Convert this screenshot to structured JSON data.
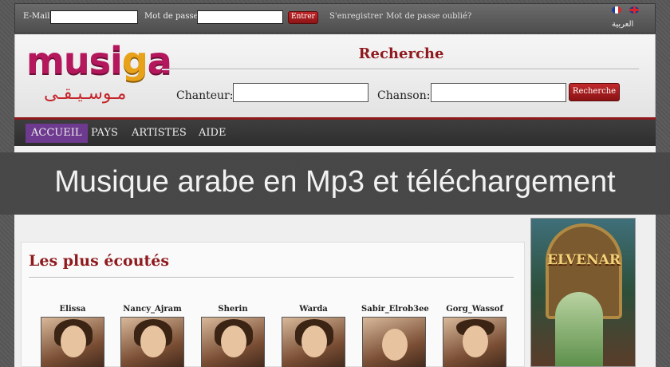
{
  "login": {
    "email_label": "E-Mail",
    "password_label": "Mot de passe",
    "enter_label": "Entrer",
    "register_label": "S'enregistrer",
    "forgot_label": "Mot de passe oublié?",
    "arabic_label": "العربية"
  },
  "header": {
    "logo_text_a": "musi",
    "logo_text_b": "g",
    "logo_text_c": "a",
    "logo_arabic": "مـوسـيـقـى",
    "search_title": "Recherche",
    "singer_label": "Chanteur:",
    "song_label": "Chanson:",
    "search_button": "Recherche"
  },
  "nav": {
    "items": [
      {
        "label": "ACCUEIL",
        "active": true
      },
      {
        "label": "PAYS",
        "active": false
      },
      {
        "label": "ARTISTES",
        "active": false
      },
      {
        "label": "AIDE",
        "active": false
      }
    ]
  },
  "banner": {
    "text": "Musique arabe en Mp3 et téléchargement"
  },
  "most_listened": {
    "title": "Les plus écoutés",
    "artists": [
      {
        "name": "Elissa"
      },
      {
        "name": "Nancy_Ajram"
      },
      {
        "name": "Sherin"
      },
      {
        "name": "Warda"
      },
      {
        "name": "Sabir_Elrob3ee"
      },
      {
        "name": "Gorg_Wassof"
      }
    ]
  },
  "ad": {
    "title": "ELVENAR"
  },
  "colors": {
    "accent": "#8f1a1e",
    "nav_active": "#6e3a8f",
    "logo_pink": "#b5175c",
    "logo_orange": "#e8a21a"
  }
}
